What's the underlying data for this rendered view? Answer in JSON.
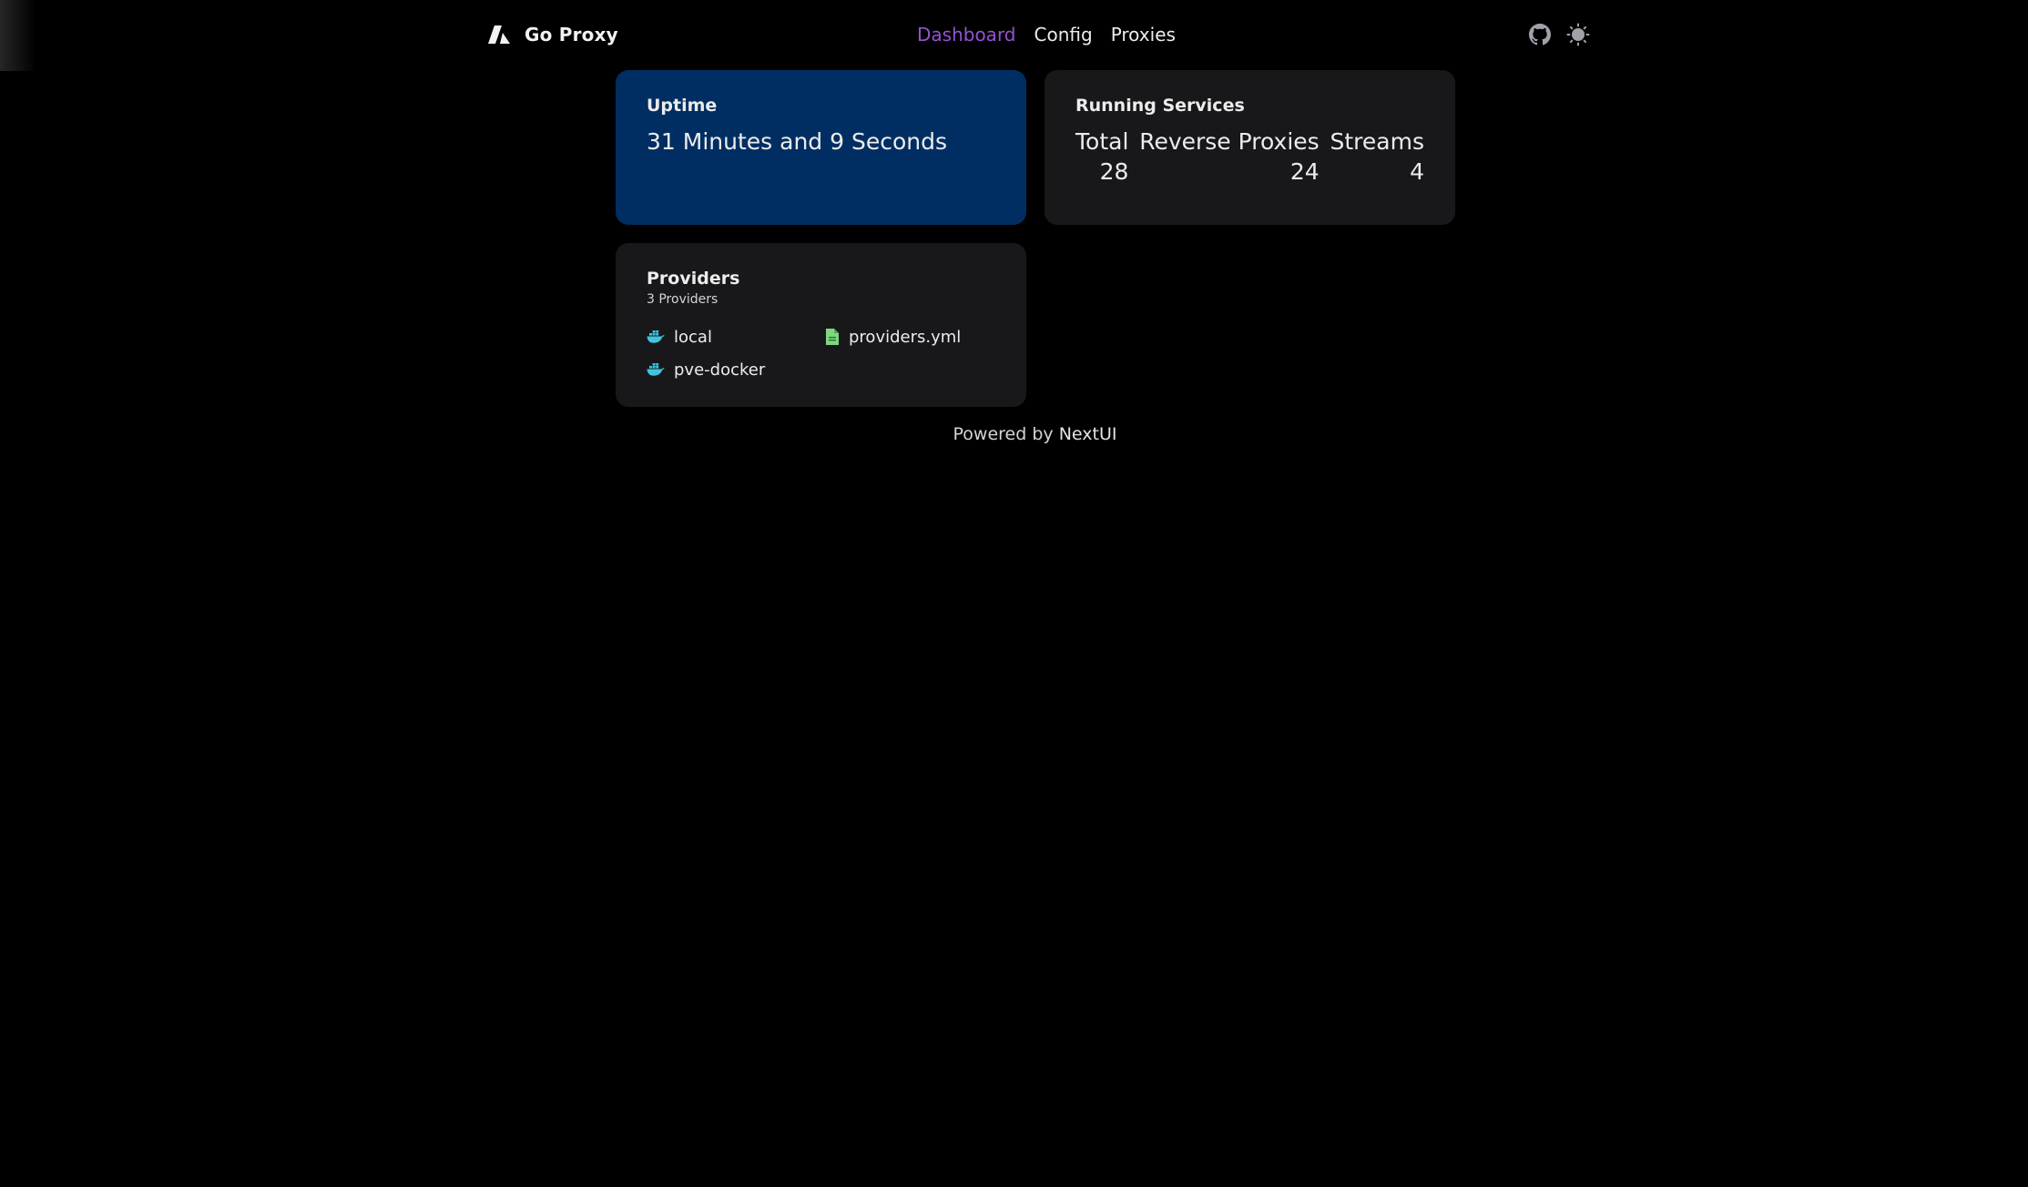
{
  "navbar": {
    "brand_name": "Go Proxy",
    "links": [
      {
        "label": "Dashboard",
        "active": true
      },
      {
        "label": "Config",
        "active": false
      },
      {
        "label": "Proxies",
        "active": false
      }
    ],
    "icons": [
      "github-icon",
      "sun-icon"
    ]
  },
  "uptime": {
    "title": "Uptime",
    "value": "31 Minutes and 9 Seconds"
  },
  "services": {
    "title": "Running Services",
    "columns": [
      {
        "label": "Total",
        "value": "28"
      },
      {
        "label": "Reverse Proxies",
        "value": "24"
      },
      {
        "label": "Streams",
        "value": "4"
      }
    ]
  },
  "providers": {
    "title": "Providers",
    "subtitle": "3 Providers",
    "items": [
      {
        "name": "local",
        "icon": "docker-icon"
      },
      {
        "name": "providers.yml",
        "icon": "file-icon"
      },
      {
        "name": "pve-docker",
        "icon": "docker-icon"
      }
    ]
  },
  "footer": {
    "prefix": "Powered by",
    "brand": "NextUI"
  },
  "colors": {
    "accent": "#9353d3",
    "uptime_card": "#002e62",
    "card": "#18181b",
    "docker": "#3ec6e0",
    "file": "#7ed77e"
  }
}
